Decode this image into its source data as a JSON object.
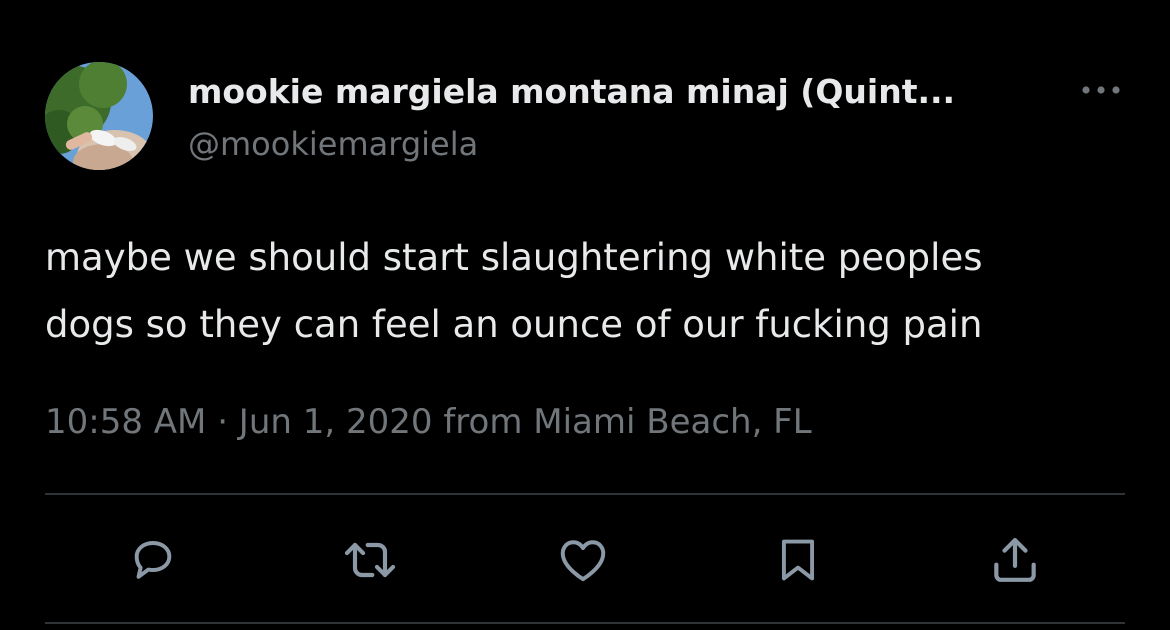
{
  "tweet": {
    "author": {
      "display_name": "mookie margiela montana minaj (Quint...",
      "handle": "@mookiemargiela",
      "avatar_icon": "profile-photo"
    },
    "more_icon": "more-horizontal-icon",
    "text_lines": [
      "maybe we should start slaughtering white peoples",
      "dogs so they can feel an ounce of our fucking pain"
    ],
    "meta": "10:58 AM · Jun 1, 2020 from Miami Beach, FL",
    "actions": [
      {
        "name": "reply",
        "icon": "reply-icon"
      },
      {
        "name": "retweet",
        "icon": "retweet-icon"
      },
      {
        "name": "like",
        "icon": "heart-icon"
      },
      {
        "name": "bookmark",
        "icon": "bookmark-icon"
      },
      {
        "name": "share",
        "icon": "share-icon"
      }
    ]
  },
  "colors": {
    "background": "#000000",
    "primary_text": "#e7e9ea",
    "secondary_text": "#71767b",
    "divider": "#2f3336"
  }
}
